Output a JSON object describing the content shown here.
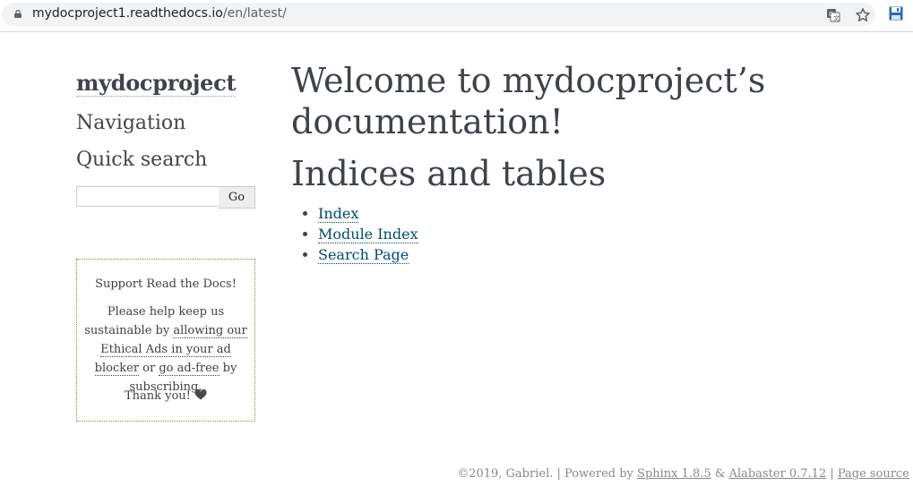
{
  "browser": {
    "url_host": "mydocproject1.readthedocs.io",
    "url_path": "/en/latest/"
  },
  "sidebar": {
    "logo": "mydocproject",
    "navigation_heading": "Navigation",
    "quick_search_heading": "Quick search",
    "search_value": "",
    "go_label": "Go"
  },
  "ad": {
    "title": "Support Read the Docs!",
    "body_prefix": "Please help keep us sustainable by ",
    "link1": "allowing our Ethical Ads in your ad blocker",
    "body_middle": " or ",
    "link2": "go ad-free",
    "body_suffix": " by subscribing.",
    "thanks": "Thank you!"
  },
  "main": {
    "title": "Welcome to mydocproject’s documentation!",
    "section_heading": "Indices and tables",
    "links": [
      "Index",
      "Module Index",
      "Search Page"
    ]
  },
  "footer": {
    "copyright": "©2019, Gabriel. | Powered by ",
    "sphinx": "Sphinx 1.8.5",
    "amp": " & ",
    "alabaster": "Alabaster 0.7.12",
    "sep": " | ",
    "page_source": "Page source"
  },
  "colors": {
    "link": "#004b6b",
    "ad_border": "#6a9a3a"
  }
}
